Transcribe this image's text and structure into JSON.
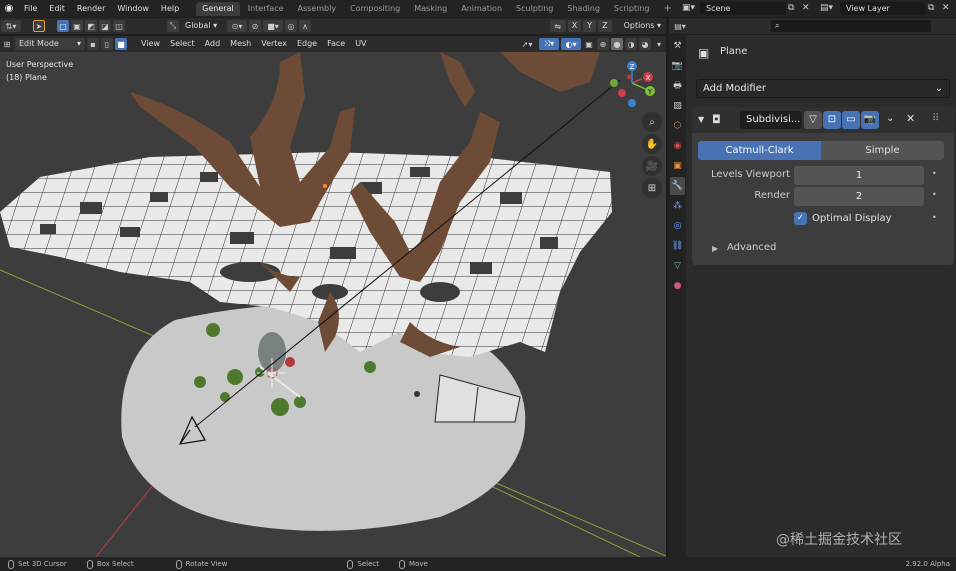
{
  "topbar": {
    "menus": [
      "File",
      "Edit",
      "Render",
      "Window",
      "Help"
    ],
    "workspaces": [
      "General",
      "Interface",
      "Assembly",
      "Compositing",
      "Masking",
      "Animation",
      "Sculpting",
      "Shading",
      "Scripting"
    ],
    "active_workspace": "General",
    "add_tab": "+",
    "scene": "Scene",
    "view_layer": "View Layer"
  },
  "viewport_header": {
    "transform_orientation": "Global",
    "axes": [
      "X",
      "Y",
      "Z"
    ],
    "options": "Options",
    "mode": "Edit Mode",
    "menus": [
      "View",
      "Select",
      "Add",
      "Mesh",
      "Vertex",
      "Edge",
      "Face",
      "UV"
    ]
  },
  "viewport": {
    "perspective": "User Perspective",
    "object": "(18) Plane",
    "gizmo": {
      "x": "X",
      "y": "Y",
      "z": "Z"
    },
    "colors": {
      "x_axis": "#d13a4a",
      "y_axis": "#7fbf3a",
      "z_axis": "#3d7fd1",
      "background": "#3d3d3d"
    }
  },
  "properties": {
    "object_name": "Plane",
    "add_modifier": "Add Modifier",
    "modifier_name": "Subdivisi...",
    "type_options": [
      "Catmull-Clark",
      "Simple"
    ],
    "active_type": "Catmull-Clark",
    "levels_viewport_label": "Levels Viewport",
    "levels_viewport_value": "1",
    "render_label": "Render",
    "render_value": "2",
    "optimal_display_label": "Optimal Display",
    "advanced_label": "Advanced"
  },
  "statusbar": {
    "items": [
      "Set 3D Cursor",
      "Box Select",
      "Rotate View",
      "Select",
      "Move"
    ],
    "version": "2.92.0 Alpha"
  },
  "watermark": "@稀土掘金技术社区"
}
